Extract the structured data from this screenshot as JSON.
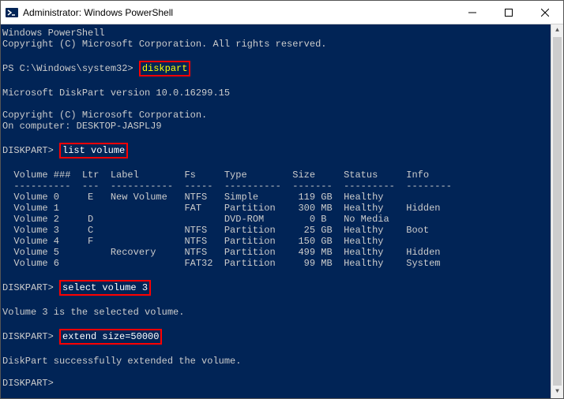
{
  "window": {
    "title": "Administrator: Windows PowerShell"
  },
  "header": {
    "line1": "Windows PowerShell",
    "line2": "Copyright (C) Microsoft Corporation. All rights reserved."
  },
  "prompt1": {
    "prefix": "PS C:\\Windows\\system32> ",
    "cmd": "diskpart"
  },
  "diskpart": {
    "version": "Microsoft DiskPart version 10.0.16299.15",
    "copyright": "Copyright (C) Microsoft Corporation.",
    "computer": "On computer: DESKTOP-JASPLJ9"
  },
  "dp_prompt": "DISKPART> ",
  "cmd_list": "list volume",
  "table_header": "  Volume ###  Ltr  Label        Fs     Type        Size     Status     Info",
  "table_divider": "  ----------  ---  -----------  -----  ----------  -------  ---------  --------",
  "volumes": [
    "  Volume 0     E   New Volume   NTFS   Simple       119 GB  Healthy",
    "  Volume 1                      FAT    Partition    300 MB  Healthy    Hidden",
    "  Volume 2     D                       DVD-ROM        0 B   No Media",
    "  Volume 3     C                NTFS   Partition     25 GB  Healthy    Boot",
    "  Volume 4     F                NTFS   Partition    150 GB  Healthy",
    "  Volume 5         Recovery     NTFS   Partition    499 MB  Healthy    Hidden",
    "  Volume 6                      FAT32  Partition     99 MB  Healthy    System"
  ],
  "cmd_select": "select volume 3",
  "select_result": "Volume 3 is the selected volume.",
  "cmd_extend": "extend size=50000",
  "extend_result": "DiskPart successfully extended the volume.",
  "chart_data": {
    "type": "table",
    "title": "list volume",
    "columns": [
      "Volume ###",
      "Ltr",
      "Label",
      "Fs",
      "Type",
      "Size",
      "Status",
      "Info"
    ],
    "rows": [
      {
        "Volume ###": "Volume 0",
        "Ltr": "E",
        "Label": "New Volume",
        "Fs": "NTFS",
        "Type": "Simple",
        "Size": "119 GB",
        "Status": "Healthy",
        "Info": ""
      },
      {
        "Volume ###": "Volume 1",
        "Ltr": "",
        "Label": "",
        "Fs": "FAT",
        "Type": "Partition",
        "Size": "300 MB",
        "Status": "Healthy",
        "Info": "Hidden"
      },
      {
        "Volume ###": "Volume 2",
        "Ltr": "D",
        "Label": "",
        "Fs": "",
        "Type": "DVD-ROM",
        "Size": "0 B",
        "Status": "No Media",
        "Info": ""
      },
      {
        "Volume ###": "Volume 3",
        "Ltr": "C",
        "Label": "",
        "Fs": "NTFS",
        "Type": "Partition",
        "Size": "25 GB",
        "Status": "Healthy",
        "Info": "Boot"
      },
      {
        "Volume ###": "Volume 4",
        "Ltr": "F",
        "Label": "",
        "Fs": "NTFS",
        "Type": "Partition",
        "Size": "150 GB",
        "Status": "Healthy",
        "Info": ""
      },
      {
        "Volume ###": "Volume 5",
        "Ltr": "",
        "Label": "Recovery",
        "Fs": "NTFS",
        "Type": "Partition",
        "Size": "499 MB",
        "Status": "Healthy",
        "Info": "Hidden"
      },
      {
        "Volume ###": "Volume 6",
        "Ltr": "",
        "Label": "",
        "Fs": "FAT32",
        "Type": "Partition",
        "Size": "99 MB",
        "Status": "Healthy",
        "Info": "System"
      }
    ]
  }
}
